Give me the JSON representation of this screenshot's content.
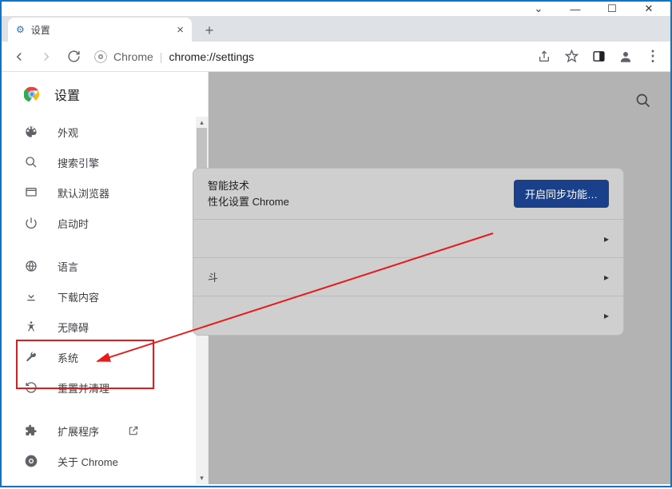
{
  "window": {
    "minimize": "—",
    "maximize": "☐",
    "close": "✕",
    "dropdown": "⌄"
  },
  "tab": {
    "title": "设置",
    "close": "×",
    "new": "+"
  },
  "toolbar": {
    "back": "←",
    "forward": "→",
    "reload": "⟳",
    "app_label": "Chrome",
    "url": "chrome://settings",
    "share": "⇪",
    "star": "☆",
    "panel": "▣",
    "profile": "👤",
    "menu": "⋮"
  },
  "sidebar": {
    "title": "设置",
    "items": [
      {
        "label": "外观",
        "icon": "palette"
      },
      {
        "label": "搜索引擎",
        "icon": "search"
      },
      {
        "label": "默认浏览器",
        "icon": "browser"
      },
      {
        "label": "启动时",
        "icon": "power"
      }
    ],
    "items2": [
      {
        "label": "语言",
        "icon": "globe"
      },
      {
        "label": "下载内容",
        "icon": "download"
      },
      {
        "label": "无障碍",
        "icon": "accessibility"
      },
      {
        "label": "系统",
        "icon": "wrench"
      },
      {
        "label": "重置并清理",
        "icon": "restore"
      }
    ],
    "items3": [
      {
        "label": "扩展程序",
        "icon": "puzzle",
        "external": true
      },
      {
        "label": "关于 Chrome",
        "icon": "chrome"
      }
    ]
  },
  "main": {
    "card_head_line1": "智能技术",
    "card_head_line2": "性化设置 Chrome",
    "sync_button": "开启同步功能…",
    "row2_suffix": "斗",
    "chev": "▸"
  }
}
